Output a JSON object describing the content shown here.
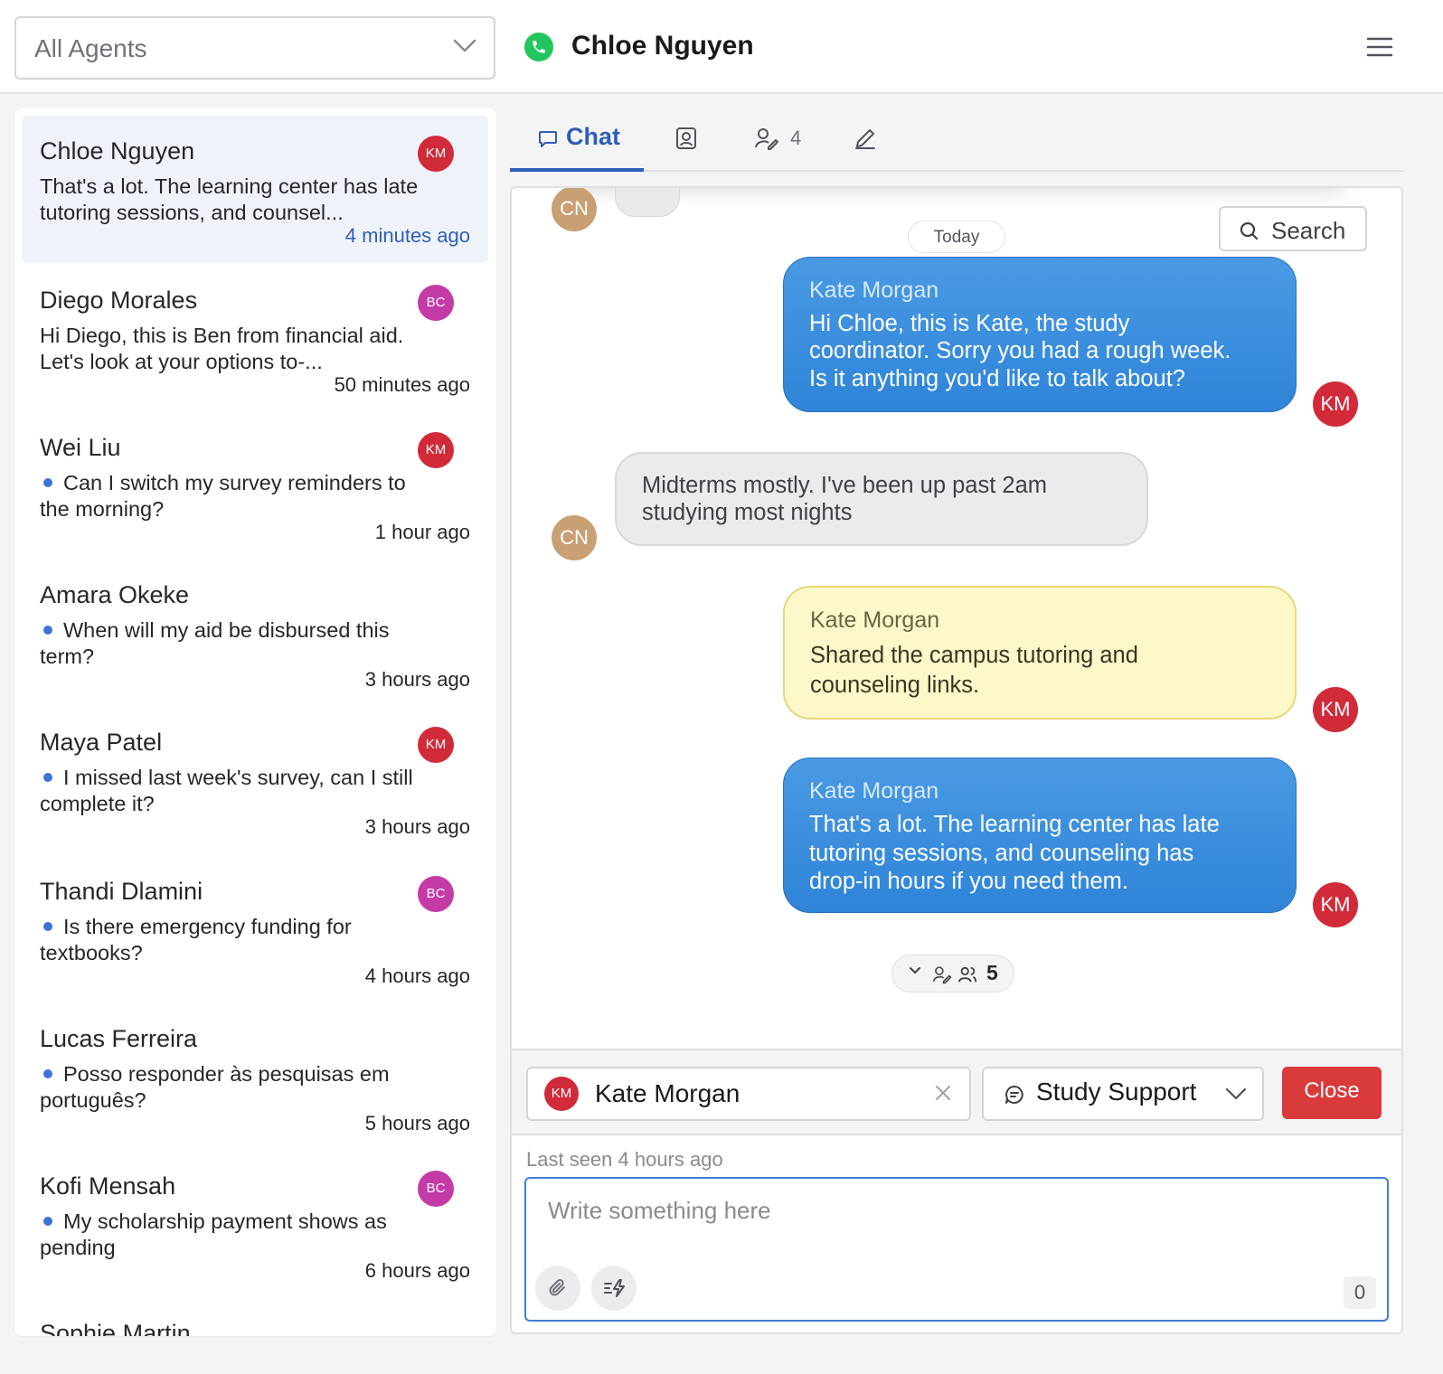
{
  "header": {
    "agent_filter": "All Agents",
    "contact_name": "Chloe Nguyen",
    "channel_icon": "phone-icon",
    "status_color": "#22c55e"
  },
  "conversations": [
    {
      "name": "Chloe Nguyen",
      "preview": "That's a lot. The learning center has late tutoring sessions, and counsel...",
      "time": "4 minutes ago",
      "agent_initials": "KM",
      "unread": false,
      "active": true
    },
    {
      "name": "Diego Morales",
      "preview": "Hi Diego, this is Ben from financial aid. Let's look at your options to-...",
      "time": "50 minutes ago",
      "agent_initials": "BC",
      "unread": false,
      "active": false
    },
    {
      "name": "Wei Liu",
      "preview": "Can I switch my survey reminders to the morning?",
      "time": "1 hour ago",
      "agent_initials": "KM",
      "unread": true,
      "active": false
    },
    {
      "name": "Amara Okeke",
      "preview": "When will my aid be disbursed this term?",
      "time": "3 hours ago",
      "agent_initials": "",
      "unread": true,
      "active": false
    },
    {
      "name": "Maya Patel",
      "preview": "I missed last week's survey, can I still complete it?",
      "time": "3 hours ago",
      "agent_initials": "KM",
      "unread": true,
      "active": false
    },
    {
      "name": "Thandi Dlamini",
      "preview": "Is there emergency funding for textbooks?",
      "time": "4 hours ago",
      "agent_initials": "BC",
      "unread": true,
      "active": false
    },
    {
      "name": "Lucas Ferreira",
      "preview": "Posso responder às pesquisas em português?",
      "time": "5 hours ago",
      "agent_initials": "",
      "unread": true,
      "active": false
    },
    {
      "name": "Kofi Mensah",
      "preview": "My scholarship payment shows as pending",
      "time": "6 hours ago",
      "agent_initials": "BC",
      "unread": true,
      "active": false
    }
  ],
  "partial_conversation_name": "Sophie Martin",
  "tabs": {
    "chat_label": "Chat",
    "notes_count": "4"
  },
  "chat": {
    "date_divider": "Today",
    "search_label": "Search",
    "customer_initials": "CN",
    "agent_initials": "KM",
    "messages": [
      {
        "type": "agent",
        "sender": "Kate Morgan",
        "lines": [
          "Hi Chloe, this is Kate, the study",
          "coordinator. Sorry you had a rough week.",
          "Is it anything you'd like to talk about?"
        ]
      },
      {
        "type": "customer",
        "lines": [
          "Midterms mostly. I've been up past 2am",
          "studying most nights"
        ]
      },
      {
        "type": "note",
        "sender": "Kate Morgan",
        "lines": [
          "Shared the campus tutoring and",
          "counseling links."
        ]
      },
      {
        "type": "agent",
        "sender": "Kate Morgan",
        "lines": [
          "That's a lot. The learning center has late",
          "tutoring sessions, and counseling has",
          "drop-in hours if you need them."
        ]
      }
    ],
    "collapsed_count": "5"
  },
  "controls": {
    "assignee_initials": "KM",
    "assignee_name": "Kate Morgan",
    "queue_name": "Study Support",
    "close_label": "Close"
  },
  "composer": {
    "last_seen": "Last seen 4 hours ago",
    "placeholder": "Write something here",
    "char_count": "0"
  },
  "colors": {
    "accent": "#2f5eb8",
    "agent_bubble": "#3b8ede",
    "note_bubble": "#fdf8c9",
    "close_button": "#d93a3a",
    "km_badge": "#d12b3a",
    "bc_badge": "#c43ba6"
  }
}
